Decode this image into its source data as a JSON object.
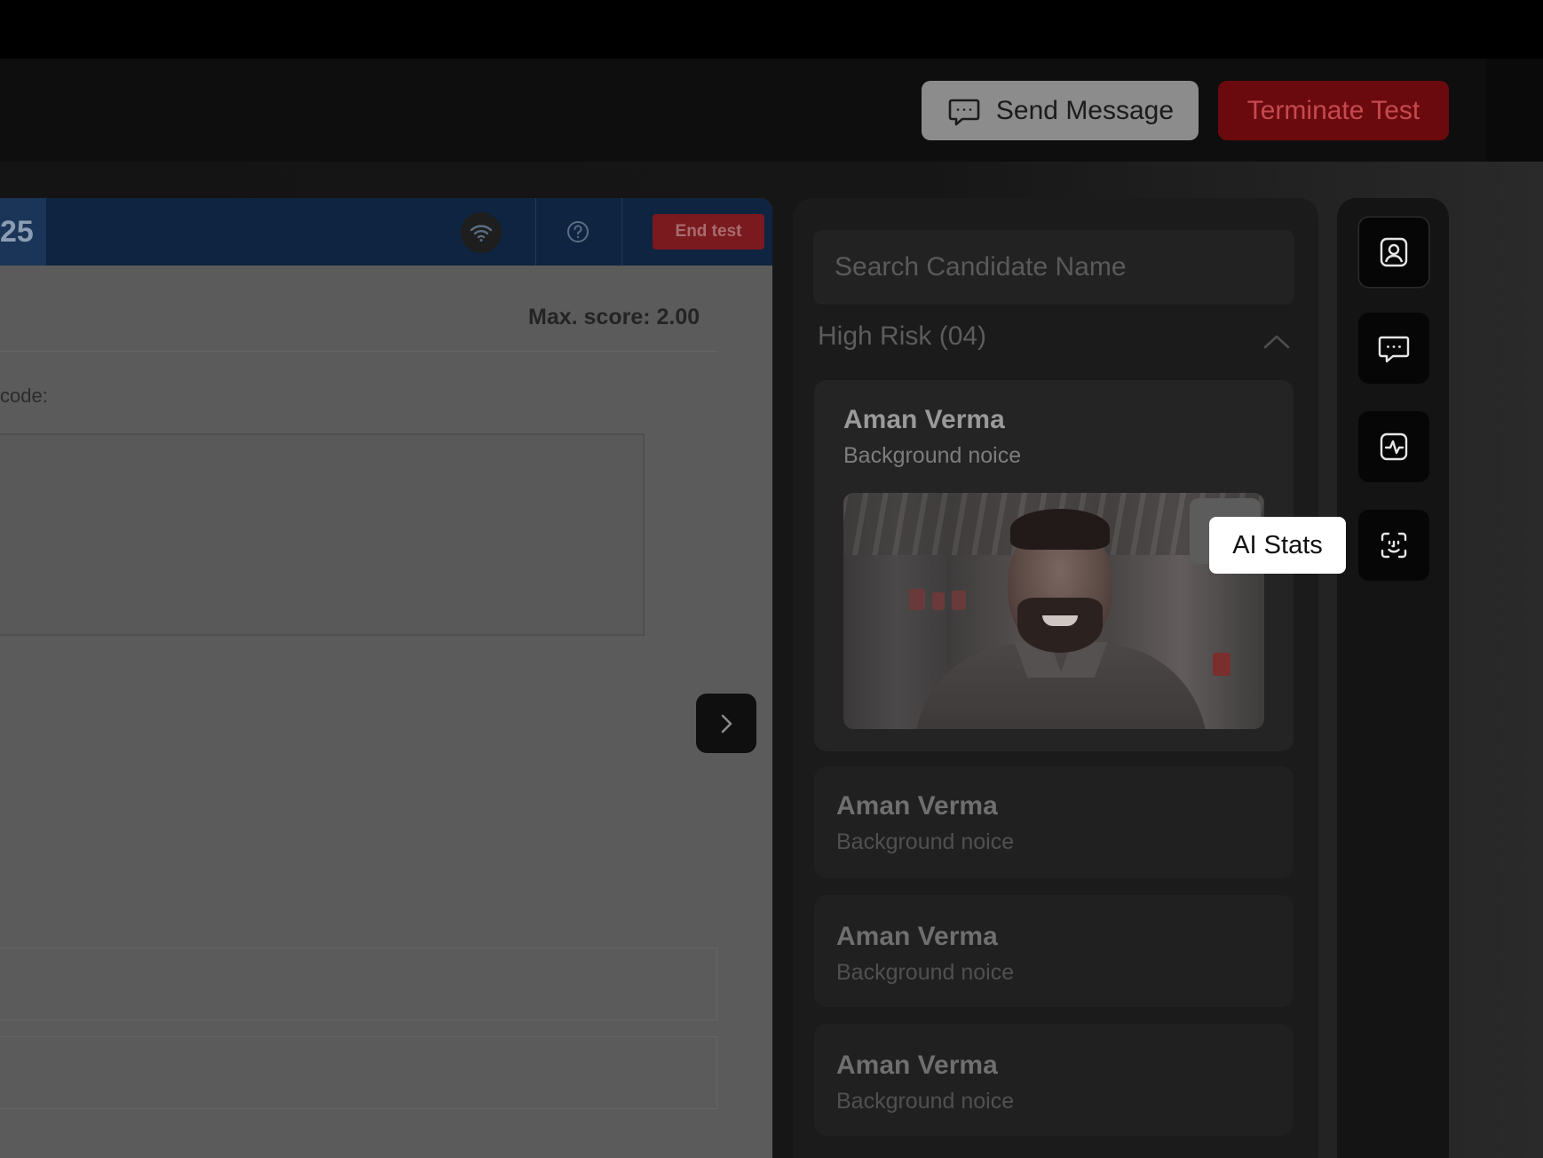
{
  "header": {
    "send_message_label": "Send Message",
    "terminate_label": "Terminate Test"
  },
  "test_preview": {
    "timer_fragment": "25",
    "end_test_label": "End test",
    "max_score_text": "Max. score: 2.00",
    "code_label": "code:"
  },
  "candidates": {
    "search_placeholder": "Search Candidate Name",
    "section_title": "High Risk (04)",
    "items": [
      {
        "name": "Aman Verma",
        "reason": "Background noice"
      },
      {
        "name": "Aman Verma",
        "reason": "Background noice"
      },
      {
        "name": "Aman Verma",
        "reason": "Background noice"
      },
      {
        "name": "Aman Verma",
        "reason": "Background noice"
      }
    ]
  },
  "rail": {
    "buttons": [
      {
        "icon": "user-profile-icon"
      },
      {
        "icon": "chat-icon"
      },
      {
        "icon": "activity-icon"
      },
      {
        "icon": "face-scan-icon"
      }
    ],
    "tooltip_label": "AI Stats"
  },
  "colors": {
    "terminate_bg": "#6b0a0e",
    "terminate_text": "#c44a4e",
    "test_header_bg": "#0e2440",
    "tooltip_bg": "#ffffff"
  }
}
